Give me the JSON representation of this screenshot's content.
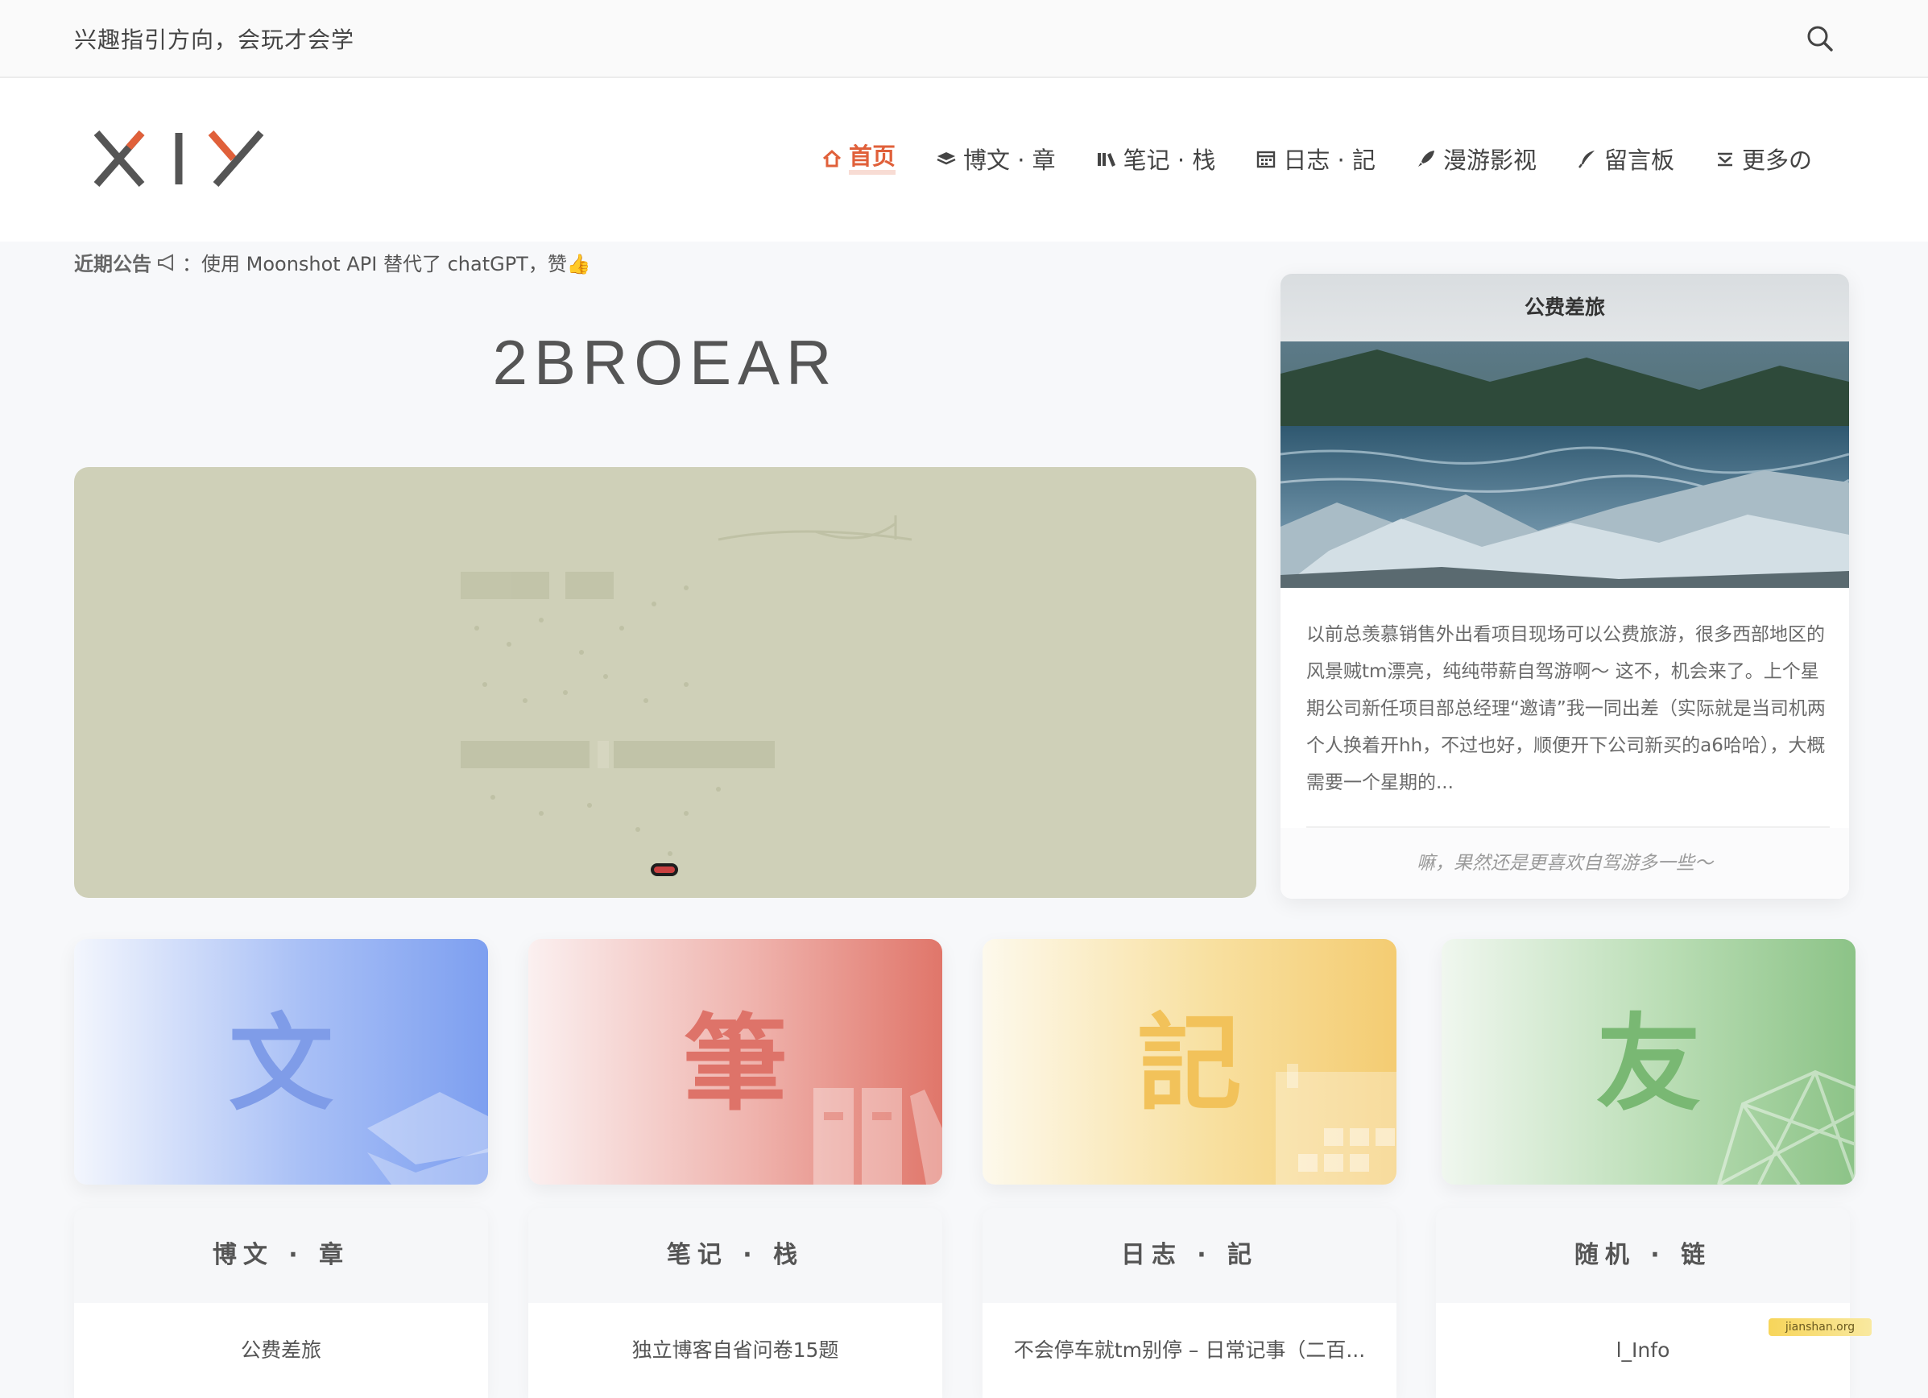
{
  "topbar": {
    "slogan": "兴趣指引方向，会玩才会学"
  },
  "nav": {
    "items": [
      {
        "label": "首页",
        "icon": "home-icon"
      },
      {
        "label": "博文 · 章",
        "icon": "layers-icon"
      },
      {
        "label": "笔记 · 栈",
        "icon": "books-icon"
      },
      {
        "label": "日志 · 記",
        "icon": "calendar-icon"
      },
      {
        "label": "漫游影视",
        "icon": "rocket-icon"
      },
      {
        "label": "留言板",
        "icon": "feather-icon"
      },
      {
        "label": "更多の",
        "icon": "download-icon"
      }
    ]
  },
  "notice": {
    "head": "近期公告",
    "text": "：使用 Moonshot API 替代了 chatGPT，赞👍"
  },
  "site_title": "2BROEAR",
  "feature": {
    "title": "公费差旅",
    "excerpt": "以前总羡慕销售外出看项目现场可以公费旅游，很多西部地区的风景贼tm漂亮，纯纯带薪自驾游啊～ 这不，机会来了。上个星期公司新任项目部总经理“邀请”我一同出差（实际就是当司机两个人换着开hh，不过也好，顺便开下公司新买的a6哈哈），大概需要一个星期的...",
    "quote": "嘛，果然还是更喜欢自驾游多一些～"
  },
  "categories": [
    {
      "glyph": "文",
      "title": "博文 · 章",
      "latest": "公费差旅"
    },
    {
      "glyph": "筆",
      "title": "笔记 · 栈",
      "latest": "独立博客自省问卷15题"
    },
    {
      "glyph": "記",
      "title": "日志 · 記",
      "latest": "不会停车就tm别停 – 日常记事（二百..."
    },
    {
      "glyph": "友",
      "title": "随机 · 链",
      "latest": "l_Info"
    }
  ],
  "badge": "jianshan.org",
  "colors": {
    "accent": "#e0603a",
    "slider_bg": "#cfd0b8"
  }
}
